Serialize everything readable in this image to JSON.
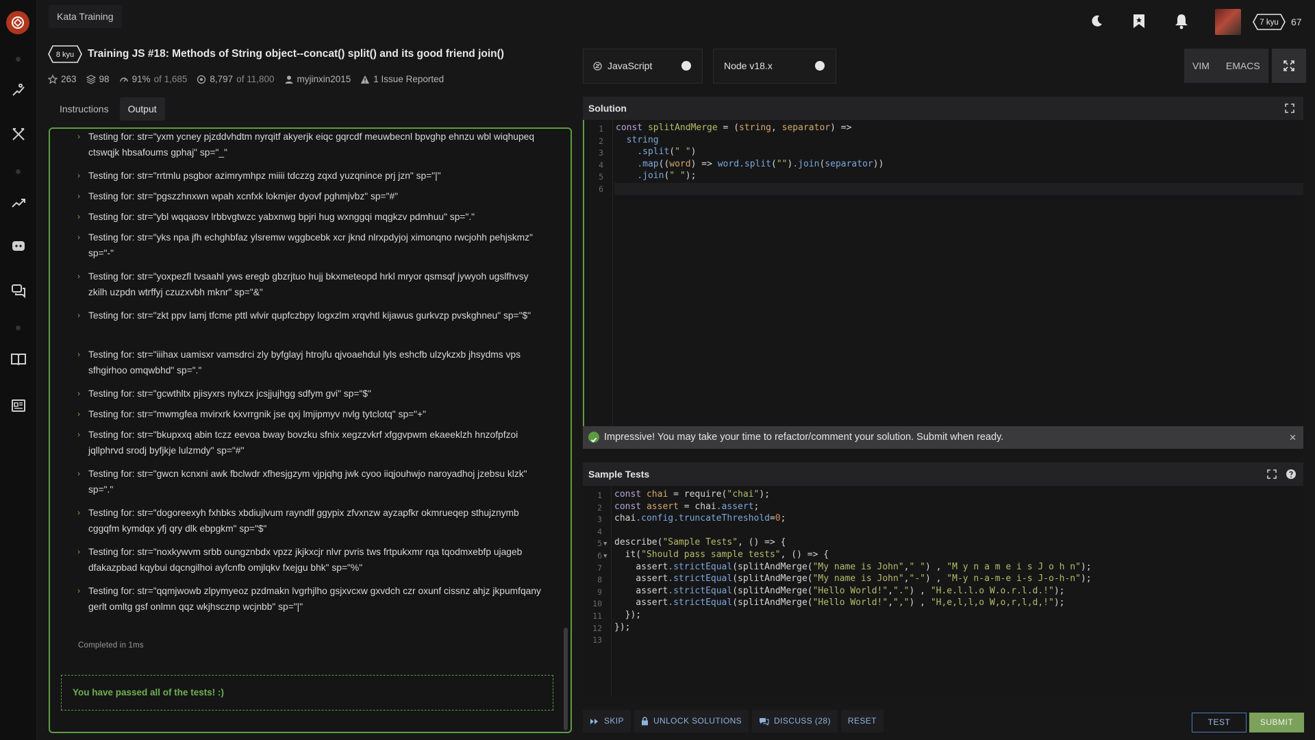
{
  "breadcrumb": "Kata Training",
  "user": {
    "rank": "7 kyu",
    "honor": "67"
  },
  "kata": {
    "rank": "8 kyu",
    "title": "Training JS #18: Methods of String object--concat() split() and its good friend join()",
    "stars": "263",
    "collections": "98",
    "satisfaction": "91%",
    "satisfaction_of": "of 1,685",
    "completed": "8,797",
    "completed_of": "of 11,800",
    "author": "myjinxin2015",
    "issues": "1 Issue Reported"
  },
  "tabs": [
    "Instructions",
    "Output"
  ],
  "output": {
    "items": [
      "Testing for: str=\"yxm ycney pjzddvhdtm nyrqitf akyerjk eiqc gqrcdf meuwbecnl bpvghp ehnzu wbl wiqhupeq ctswqjk hbsafoums gphaj\"  sp=\"_\"",
      "Testing for: str=\"rrtmlu psgbor azimrymhpz miiii tdczzg zqxd yuzqnince prj jzn\"  sp=\"|\"",
      "Testing for: str=\"pgszzhnxwn wpah xcnfxk lokmjer dyovf pghmjvbz\"  sp=\"#\"",
      "Testing for: str=\"ybl wqqaosv lrbbvgtwzc yabxnwg bpjri hug wxnggqi mqgkzv pdmhuu\"  sp=\".\"",
      "Testing for: str=\"yks npa jfh echghbfaz ylsremw wggbcebk xcr jknd nlrxpdyjoj ximonqno rwcjohh pehjskmz\"  sp=\"-\"",
      "Testing for: str=\"yoxpezfl tvsaahl yws eregb gbzrjtuo hujj bkxmeteopd hrkl mryor qsmsqf jywyoh ugslfhvsy zkilh uzpdn wtrffyj czuzxvbh mknr\"  sp=\"&\"",
      "Testing for: str=\"zkt ppv lamj tfcme pttl wlvir qupfczbpy logxzlm xrqvhtl kijawus gurkvzp pvskghneu\"  sp=\"$\"",
      "Testing for: str=\"iiihax uamisxr vamsdrci zly byfglayj htrojfu qjvoaehdul lyls eshcfb ulzykzxb jhsydms vps sfhgirhoo omqwbhd\"  sp=\".\"",
      "Testing for: str=\"gcwthltx pjisyxrs nylxzx jcsjjujhgg sdfym gvi\"  sp=\"$\"",
      "Testing for: str=\"mwmgfea mvirxrk kxvrrgnik jse qxj lmjipmyv nvlg tytclotq\"  sp=\"+\"",
      "Testing for: str=\"bkupxxq abin tczz eevoa bway bovzku sfnix xegzzvkrf xfggvpwm ekaeeklzh hnzofpfzoi jqllphrvd srodj byfjkje lulzmdy\"  sp=\"#\"",
      "Testing for: str=\"gwcn kcnxni awk fbclwdr xfhesjgzym vjpjqhg jwk cyoo iiqjouhwjo naroyadhoj jzebsu klzk\"  sp=\".\"",
      "Testing for: str=\"dogoreexyh fxhbks xbdiujlvum rayndlf ggypix zfvxnzw ayzapfkr okmrueqep sthujznymb cggqfm kymdqx yfj qry dlk ebpgkm\"  sp=\"$\"",
      "Testing for: str=\"noxkywvm srbb oungznbdx vpzz jkjkxcjr nlvr pvris tws frtpukxmr rqa tqodmxebfp ujageb dfakazpbad kqybui dqcngilhoi ayfcnfb omjlqkv fxejgu bhk\"  sp=\"%\"",
      "Testing for: str=\"qqmjwowb zlpymyeoz pzdmakn lvgrhjlho gsjxvcxw gxvdch czr oxunf cissnz ahjz jkpumfqany gerlt omltg gsf onlmn qqz wkjhscznp wcjnbb\"  sp=\"|\""
    ],
    "completed": "Completed in 1ms",
    "passed": "You have passed all of the tests! :)"
  },
  "language": "JavaScript",
  "runtime": "Node v18.x",
  "modes": [
    "VIM",
    "EMACS"
  ],
  "solution": {
    "title": "Solution",
    "line_numbers": [
      "1",
      "2",
      "3",
      "4",
      "5",
      "6"
    ]
  },
  "toast": "Impressive! You may take your time to refactor/comment your solution. Submit when ready.",
  "tests": {
    "title": "Sample Tests",
    "line_numbers": [
      "1",
      "2",
      "3",
      "4",
      "5",
      "6",
      "7",
      "8",
      "9",
      "10",
      "11",
      "12",
      "13"
    ]
  },
  "actions": {
    "skip": "SKIP",
    "unlock": "UNLOCK SOLUTIONS",
    "discuss": "DISCUSS (28)",
    "reset": "RESET",
    "test": "TEST",
    "submit": "SUBMIT"
  },
  "colors": {
    "accent_green": "#5c9c42",
    "brand_red": "#b1361e",
    "link_blue": "#8fb3e0"
  },
  "icons": [
    "codewars-logo",
    "practice-icon",
    "dojo-icon",
    "leaderboard-icon",
    "discord-icon",
    "chat-icon",
    "docs-icon",
    "blog-icon",
    "moon-icon",
    "bookmark-icon",
    "bell-icon"
  ]
}
